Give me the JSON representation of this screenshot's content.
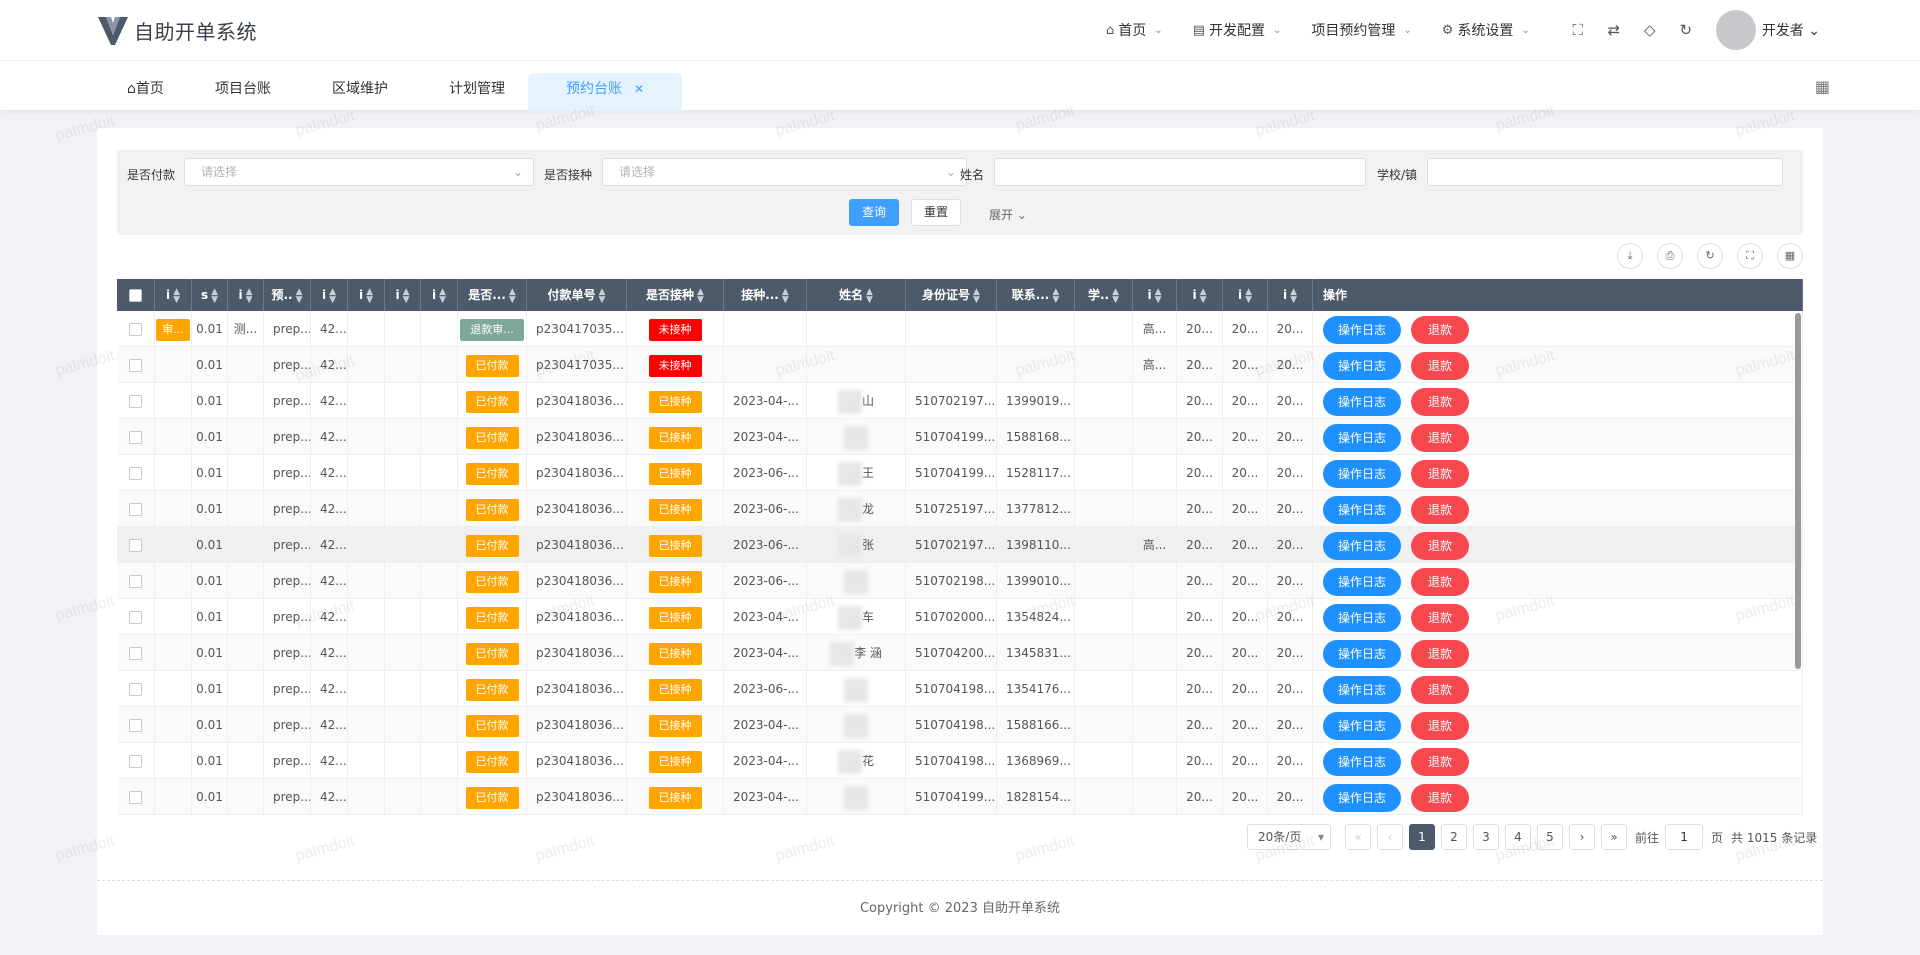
{
  "app": {
    "title": "自助开单系统"
  },
  "topnav": [
    {
      "icon": "home-icon",
      "glyph": "⌂",
      "label": "首页"
    },
    {
      "icon": "table-icon",
      "glyph": "▤",
      "label": "开发配置"
    },
    {
      "icon": "",
      "glyph": "",
      "label": "项目预约管理"
    },
    {
      "icon": "gear-icon",
      "glyph": "⚙",
      "label": "系统设置"
    }
  ],
  "user": {
    "name": "开发者"
  },
  "tabs": [
    "首页",
    "项目台账",
    "区域维护",
    "计划管理",
    "预约台账"
  ],
  "filters": {
    "paid_label": "是否付款",
    "paid_placeholder": "请选择",
    "vacc_label": "是否接种",
    "vacc_placeholder": "请选择",
    "name_label": "姓名",
    "school_label": "学校/镇",
    "query_btn": "查询",
    "reset_btn": "重置",
    "expand": "展开"
  },
  "columns": [
    "",
    "i",
    "s",
    "i",
    "预..",
    "i",
    "i",
    "i",
    "i",
    "是否...",
    "付款单号",
    "是否接种",
    "接种...",
    "姓名",
    "身份证号",
    "联系...",
    "学..",
    "i",
    "i",
    "i",
    "i",
    "操作"
  ],
  "rows": [
    {
      "tag0": "审...",
      "amt": "0.01",
      "c3": "测...",
      "pre": "prep...",
      "n": "42...",
      "pay": "退款审...",
      "payc": "grey",
      "ord": "p230417035...",
      "vac": "未接种",
      "vacc": "red",
      "date": "",
      "name": "",
      "id": "",
      "tel": "",
      "sch": "",
      "c17": "高...",
      "c18": "20...",
      "c19": "20...",
      "c20": "20..."
    },
    {
      "tag0": "",
      "amt": "0.01",
      "c3": "",
      "pre": "prep...",
      "n": "42...",
      "pay": "已付款",
      "payc": "orange",
      "ord": "p230417035...",
      "vac": "未接种",
      "vacc": "red",
      "date": "",
      "name": "",
      "id": "",
      "tel": "",
      "sch": "",
      "c17": "高...",
      "c18": "20...",
      "c19": "20...",
      "c20": "20..."
    },
    {
      "tag0": "",
      "amt": "0.01",
      "c3": "",
      "pre": "prep...",
      "n": "42...",
      "pay": "已付款",
      "payc": "orange",
      "ord": "p230418036...",
      "vac": "已接种",
      "vacc": "amber",
      "date": "2023-04-...",
      "name": "山",
      "id": "510702197...",
      "tel": "1399019...",
      "sch": "",
      "c17": "",
      "c18": "20...",
      "c19": "20...",
      "c20": "20..."
    },
    {
      "tag0": "",
      "amt": "0.01",
      "c3": "",
      "pre": "prep...",
      "n": "42...",
      "pay": "已付款",
      "payc": "orange",
      "ord": "p230418036...",
      "vac": "已接种",
      "vacc": "amber",
      "date": "2023-04-...",
      "name": "",
      "id": "510704199...",
      "tel": "1588168...",
      "sch": "",
      "c17": "",
      "c18": "20...",
      "c19": "20...",
      "c20": "20..."
    },
    {
      "tag0": "",
      "amt": "0.01",
      "c3": "",
      "pre": "prep...",
      "n": "42...",
      "pay": "已付款",
      "payc": "orange",
      "ord": "p230418036...",
      "vac": "已接种",
      "vacc": "amber",
      "date": "2023-06-...",
      "name": "王",
      "id": "510704199...",
      "tel": "1528117...",
      "sch": "",
      "c17": "",
      "c18": "20...",
      "c19": "20...",
      "c20": "20..."
    },
    {
      "tag0": "",
      "amt": "0.01",
      "c3": "",
      "pre": "prep...",
      "n": "42...",
      "pay": "已付款",
      "payc": "orange",
      "ord": "p230418036...",
      "vac": "已接种",
      "vacc": "amber",
      "date": "2023-06-...",
      "name": "龙",
      "id": "510725197...",
      "tel": "1377812...",
      "sch": "",
      "c17": "",
      "c18": "20...",
      "c19": "20...",
      "c20": "20..."
    },
    {
      "tag0": "",
      "amt": "0.01",
      "c3": "",
      "pre": "prep...",
      "n": "42...",
      "pay": "已付款",
      "payc": "orange",
      "ord": "p230418036...",
      "vac": "已接种",
      "vacc": "amber",
      "date": "2023-06-...",
      "name": "张",
      "id": "510702197...",
      "tel": "1398110...",
      "sch": "",
      "c17": "高...",
      "c18": "20...",
      "c19": "20...",
      "c20": "20..."
    },
    {
      "tag0": "",
      "amt": "0.01",
      "c3": "",
      "pre": "prep...",
      "n": "42...",
      "pay": "已付款",
      "payc": "orange",
      "ord": "p230418036...",
      "vac": "已接种",
      "vacc": "amber",
      "date": "2023-06-...",
      "name": "",
      "id": "510702198...",
      "tel": "1399010...",
      "sch": "",
      "c17": "",
      "c18": "20...",
      "c19": "20...",
      "c20": "20..."
    },
    {
      "tag0": "",
      "amt": "0.01",
      "c3": "",
      "pre": "prep...",
      "n": "42...",
      "pay": "已付款",
      "payc": "orange",
      "ord": "p230418036...",
      "vac": "已接种",
      "vacc": "amber",
      "date": "2023-04-...",
      "name": "车",
      "id": "510702000...",
      "tel": "1354824...",
      "sch": "",
      "c17": "",
      "c18": "20...",
      "c19": "20...",
      "c20": "20..."
    },
    {
      "tag0": "",
      "amt": "0.01",
      "c3": "",
      "pre": "prep...",
      "n": "42...",
      "pay": "已付款",
      "payc": "orange",
      "ord": "p230418036...",
      "vac": "已接种",
      "vacc": "amber",
      "date": "2023-04-...",
      "name": "李 涵",
      "id": "510704200...",
      "tel": "1345831...",
      "sch": "",
      "c17": "",
      "c18": "20...",
      "c19": "20...",
      "c20": "20..."
    },
    {
      "tag0": "",
      "amt": "0.01",
      "c3": "",
      "pre": "prep...",
      "n": "42...",
      "pay": "已付款",
      "payc": "orange",
      "ord": "p230418036...",
      "vac": "已接种",
      "vacc": "amber",
      "date": "2023-06-...",
      "name": "",
      "id": "510704198...",
      "tel": "1354176...",
      "sch": "",
      "c17": "",
      "c18": "20...",
      "c19": "20...",
      "c20": "20..."
    },
    {
      "tag0": "",
      "amt": "0.01",
      "c3": "",
      "pre": "prep...",
      "n": "42...",
      "pay": "已付款",
      "payc": "orange",
      "ord": "p230418036...",
      "vac": "已接种",
      "vacc": "amber",
      "date": "2023-04-...",
      "name": "",
      "id": "510704198...",
      "tel": "1588166...",
      "sch": "",
      "c17": "",
      "c18": "20...",
      "c19": "20...",
      "c20": "20..."
    },
    {
      "tag0": "",
      "amt": "0.01",
      "c3": "",
      "pre": "prep...",
      "n": "42...",
      "pay": "已付款",
      "payc": "orange",
      "ord": "p230418036...",
      "vac": "已接种",
      "vacc": "amber",
      "date": "2023-04-...",
      "name": "花",
      "id": "510704198...",
      "tel": "1368969...",
      "sch": "",
      "c17": "",
      "c18": "20...",
      "c19": "20...",
      "c20": "20..."
    },
    {
      "tag0": "",
      "amt": "0.01",
      "c3": "",
      "pre": "prep...",
      "n": "42...",
      "pay": "已付款",
      "payc": "orange",
      "ord": "p230418036...",
      "vac": "已接种",
      "vacc": "amber",
      "date": "2023-04-...",
      "name": "",
      "id": "510704199...",
      "tel": "1828154...",
      "sch": "",
      "c17": "",
      "c18": "20...",
      "c19": "20...",
      "c20": "20..."
    }
  ],
  "row_actions": {
    "log": "操作日志",
    "refund": "退款"
  },
  "pager": {
    "size": "20条/页",
    "pages": [
      "1",
      "2",
      "3",
      "4",
      "5"
    ],
    "goto": "前往",
    "current": "1",
    "page_unit": "页",
    "total": "共 1015 条记录"
  },
  "footer": {
    "copyright": "Copyright © 2023 自助开单系统"
  },
  "watermark": "palmdoit",
  "colors": {
    "header": "#4c5a69",
    "primary": "#409eff",
    "danger": "#f8484f",
    "paid": "#ffa500",
    "unvacc": "#ff0000"
  }
}
